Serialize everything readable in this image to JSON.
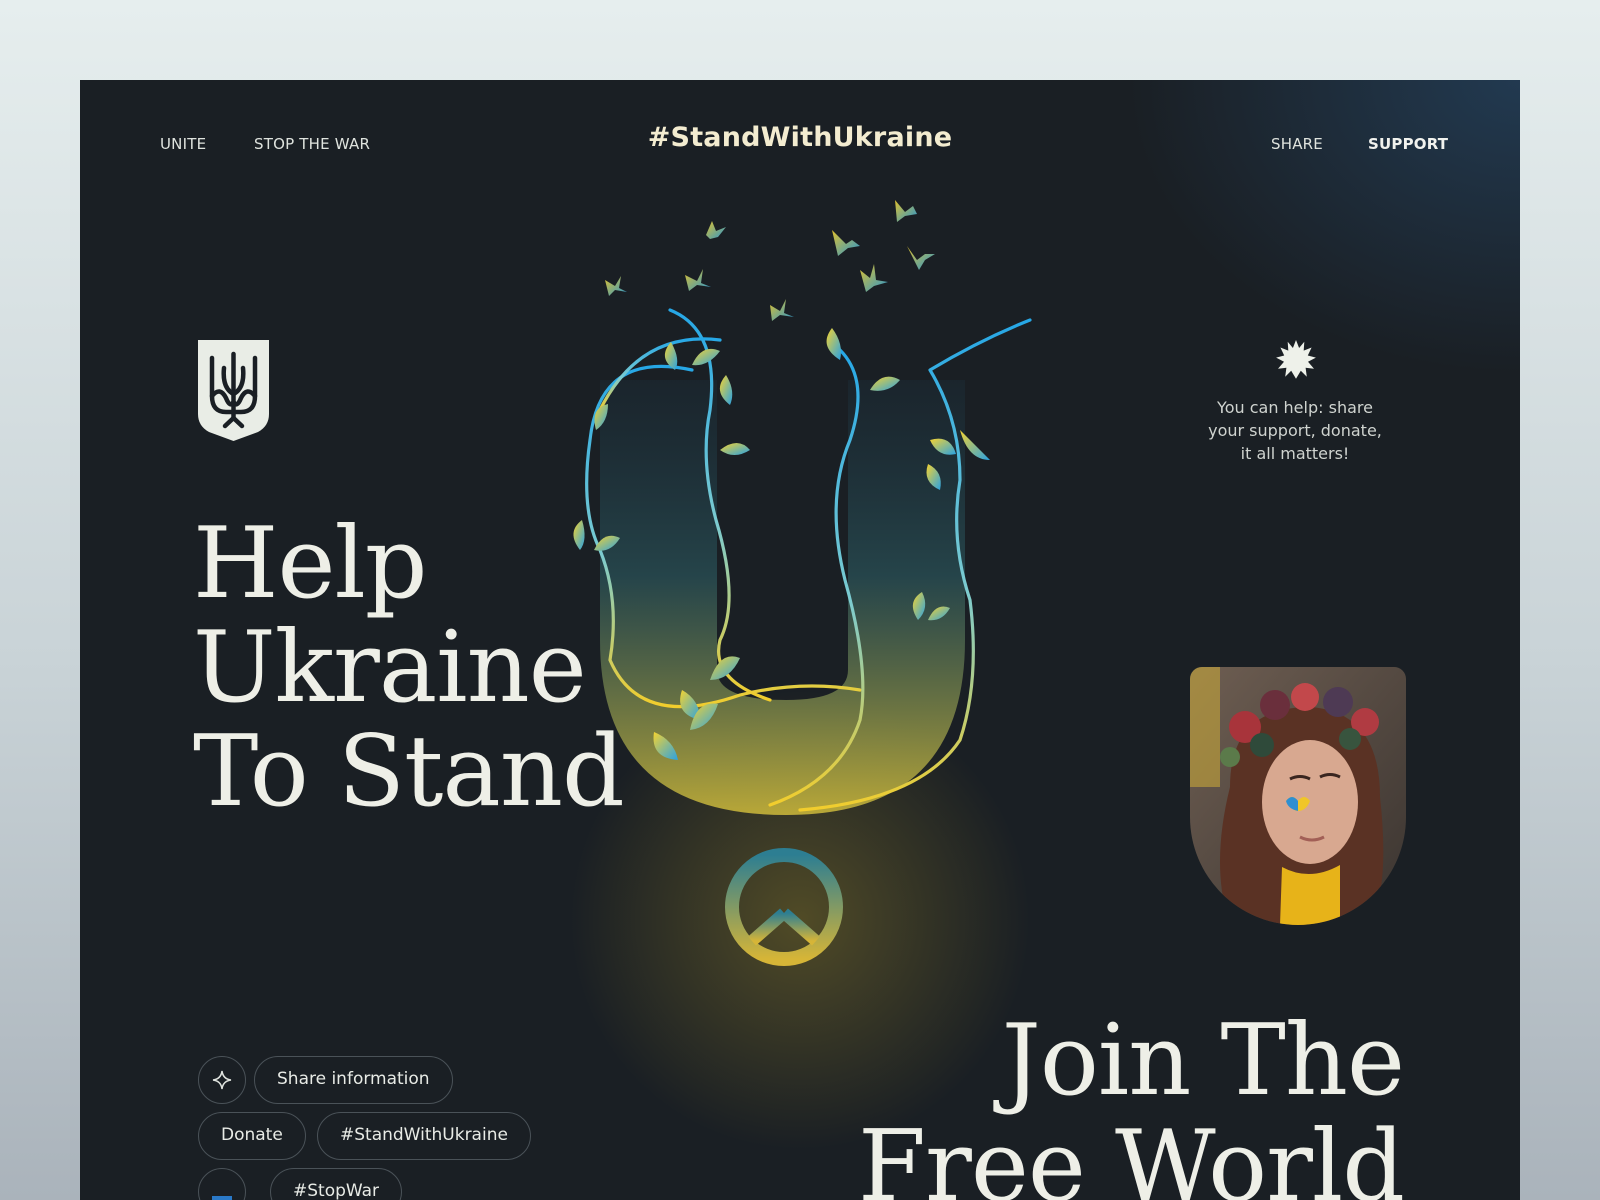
{
  "nav": {
    "left": [
      "UNITE",
      "STOP THE WAR"
    ],
    "brand": "#StandWithUkraine",
    "right": [
      "SHARE",
      "SUPPORT"
    ]
  },
  "hero": {
    "title_lines": [
      "Help",
      "Ukraine",
      "To Stand"
    ]
  },
  "help_text": [
    "You can help: share",
    "your support, donate,",
    "it all matters!"
  ],
  "chips": {
    "share": "Share information",
    "donate": "Donate",
    "hashtag1": "#StandWithUkraine",
    "hashtag2": "#StopWar",
    "flag": "🇺🇦"
  },
  "join": {
    "lines": [
      "Join The",
      "Free World"
    ]
  },
  "icons": [
    "trident-emblem-icon",
    "sun-badge-icon",
    "sparkle-star-icon",
    "peace-sign-icon",
    "dove-icon",
    "flag-ukraine-icon"
  ],
  "colors": {
    "background": "#1a1f24",
    "text": "#eeefe7",
    "brand": "#f3ecd0",
    "blue": "#1b9be0",
    "yellow": "#f4cf2e"
  }
}
